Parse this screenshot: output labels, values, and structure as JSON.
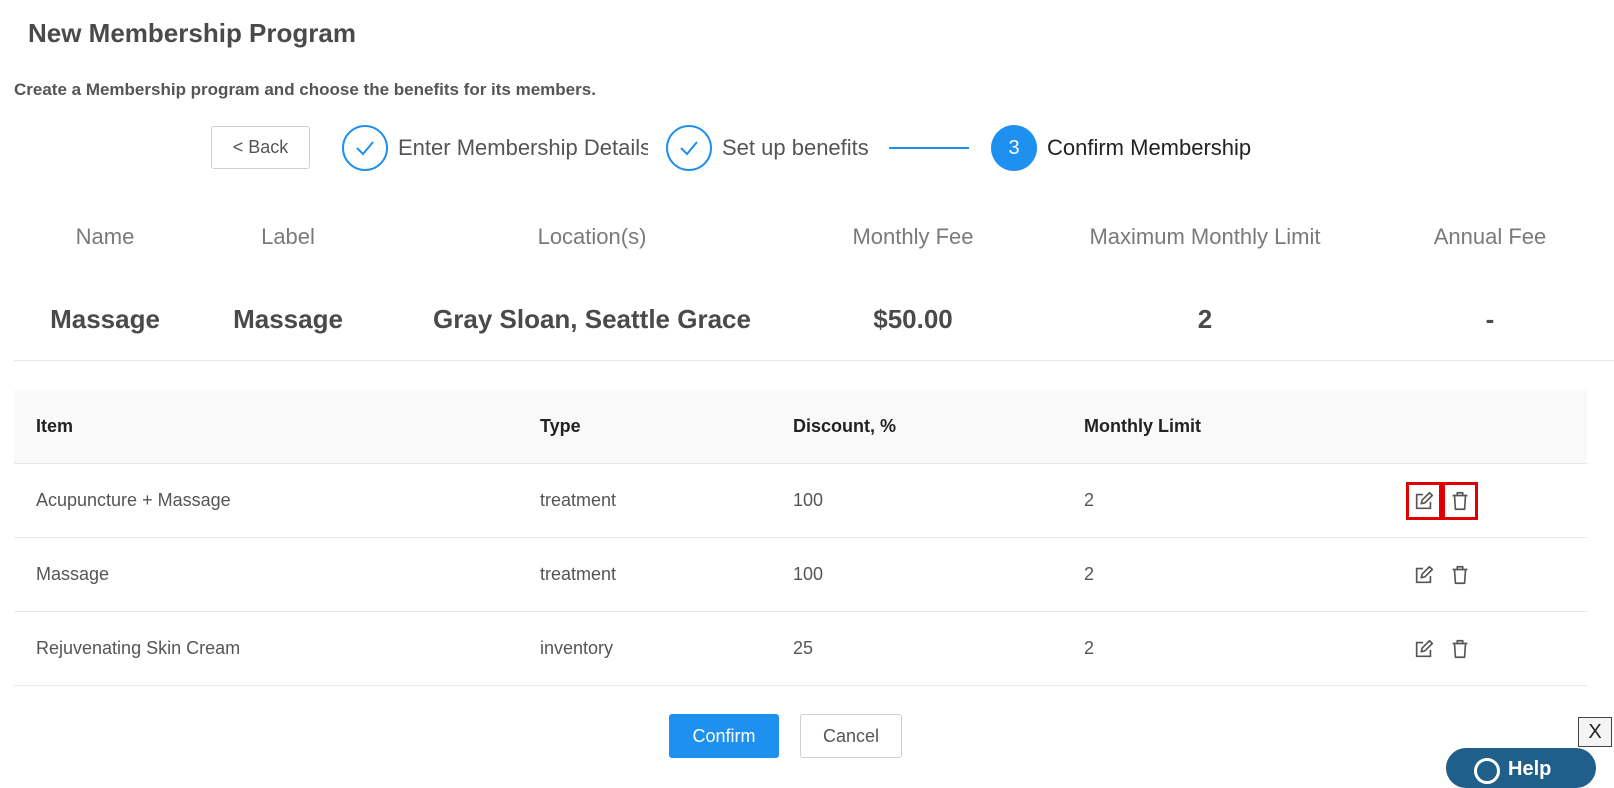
{
  "page": {
    "title": "New Membership Program",
    "subtitle": "Create a Membership program and choose the benefits for its members."
  },
  "stepper": {
    "back_label": "< Back",
    "steps": [
      {
        "label": "Enter Membership Details",
        "state": "done"
      },
      {
        "label": "Set up benefits",
        "state": "done"
      },
      {
        "number": "3",
        "label": "Confirm Membership",
        "state": "active"
      }
    ]
  },
  "summary": {
    "headers": [
      "Name",
      "Label",
      "Location(s)",
      "Monthly Fee",
      "Maximum Monthly Limit",
      "Annual Fee"
    ],
    "values": [
      "Massage",
      "Massage",
      "Gray Sloan, Seattle Grace",
      "$50.00",
      "2",
      "-"
    ]
  },
  "benefits_table": {
    "columns": [
      "Item",
      "Type",
      "Discount, %",
      "Monthly Limit"
    ],
    "rows": [
      {
        "item": "Acupuncture + Massage",
        "type": "treatment",
        "discount": "100",
        "limit": "2"
      },
      {
        "item": "Massage",
        "type": "treatment",
        "discount": "100",
        "limit": "2"
      },
      {
        "item": "Rejuvenating Skin Cream",
        "type": "inventory",
        "discount": "25",
        "limit": "2"
      }
    ]
  },
  "footer": {
    "confirm_label": "Confirm",
    "cancel_label": "Cancel",
    "close_label": "X",
    "help_label": "Help"
  },
  "colors": {
    "accent": "#1e90f0",
    "highlight": "#e00000",
    "help": "#1f5f8a"
  },
  "icons": {
    "step_done": "check-icon",
    "edit": "edit-icon",
    "delete": "trash-icon",
    "help": "help-icon"
  }
}
